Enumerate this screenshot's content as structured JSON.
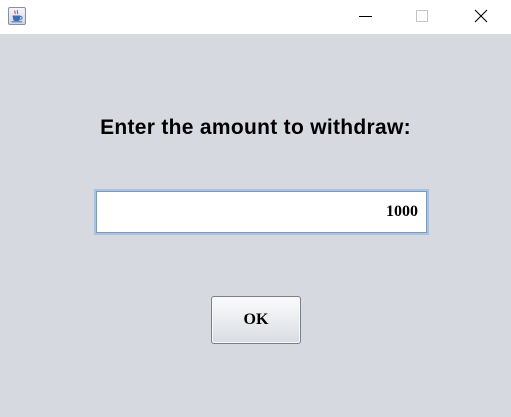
{
  "window": {
    "app_icon": "java-coffee-cup-icon",
    "controls": {
      "minimize_icon": "minimize-icon",
      "maximize_icon": "maximize-icon",
      "close_icon": "close-icon"
    }
  },
  "dialog": {
    "prompt": "Enter the amount to withdraw:",
    "amount_value": "1000",
    "ok_label": "OK"
  },
  "colors": {
    "background": "#d7d9e1",
    "input_border": "#a9c3de"
  }
}
